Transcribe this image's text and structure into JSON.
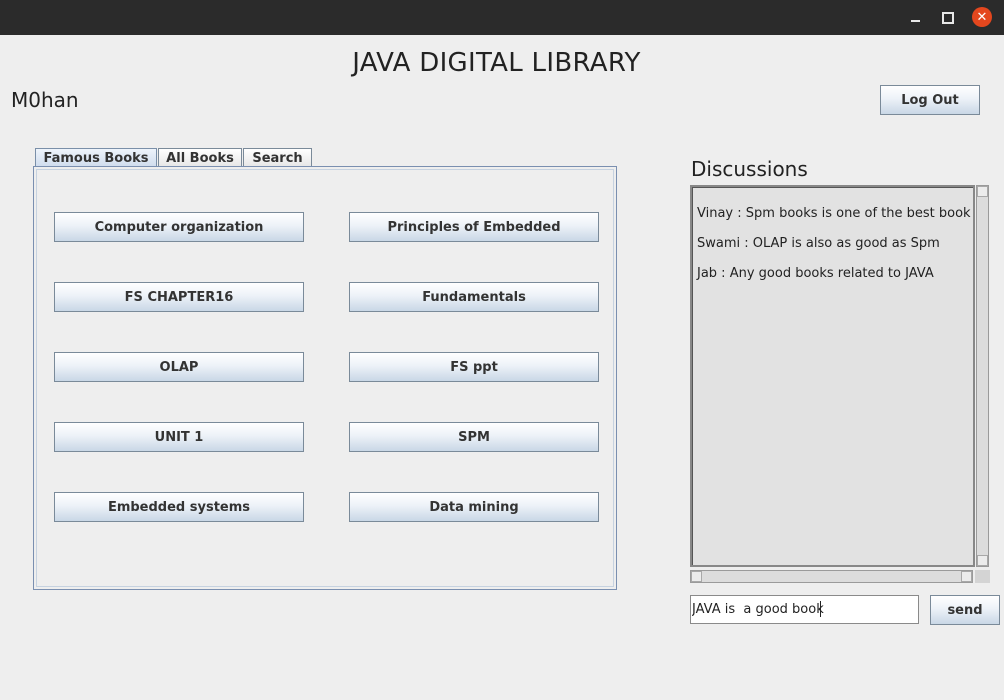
{
  "window": {
    "controls": {
      "minimize_icon": "minimize-icon",
      "maximize_icon": "maximize-icon",
      "close_icon": "close-icon",
      "close_glyph": "✕"
    }
  },
  "app": {
    "title": "JAVA DIGITAL LIBRARY",
    "user": "M0han",
    "logout_label": "Log Out"
  },
  "tabs": [
    {
      "label": "Famous Books",
      "active": true
    },
    {
      "label": "All Books",
      "active": false
    },
    {
      "label": "Search",
      "active": false
    }
  ],
  "books": [
    "Computer organization",
    "Principles of Embedded",
    "FS CHAPTER16",
    "Fundamentals",
    "OLAP",
    "FS ppt",
    "UNIT 1",
    "SPM",
    "Embedded systems",
    "Data mining"
  ],
  "discussions": {
    "title": "Discussions",
    "messages": [
      "Vinay : Spm books is one of the best book",
      "Swami : OLAP is also as good as Spm",
      "Jab : Any good books related to JAVA"
    ],
    "input_value": "JAVA is  a good book",
    "send_label": "send"
  },
  "colors": {
    "titlebar": "#2b2b2b",
    "close_button": "#e4471e",
    "background": "#eeeeee",
    "button_border": "#7a8a99"
  }
}
